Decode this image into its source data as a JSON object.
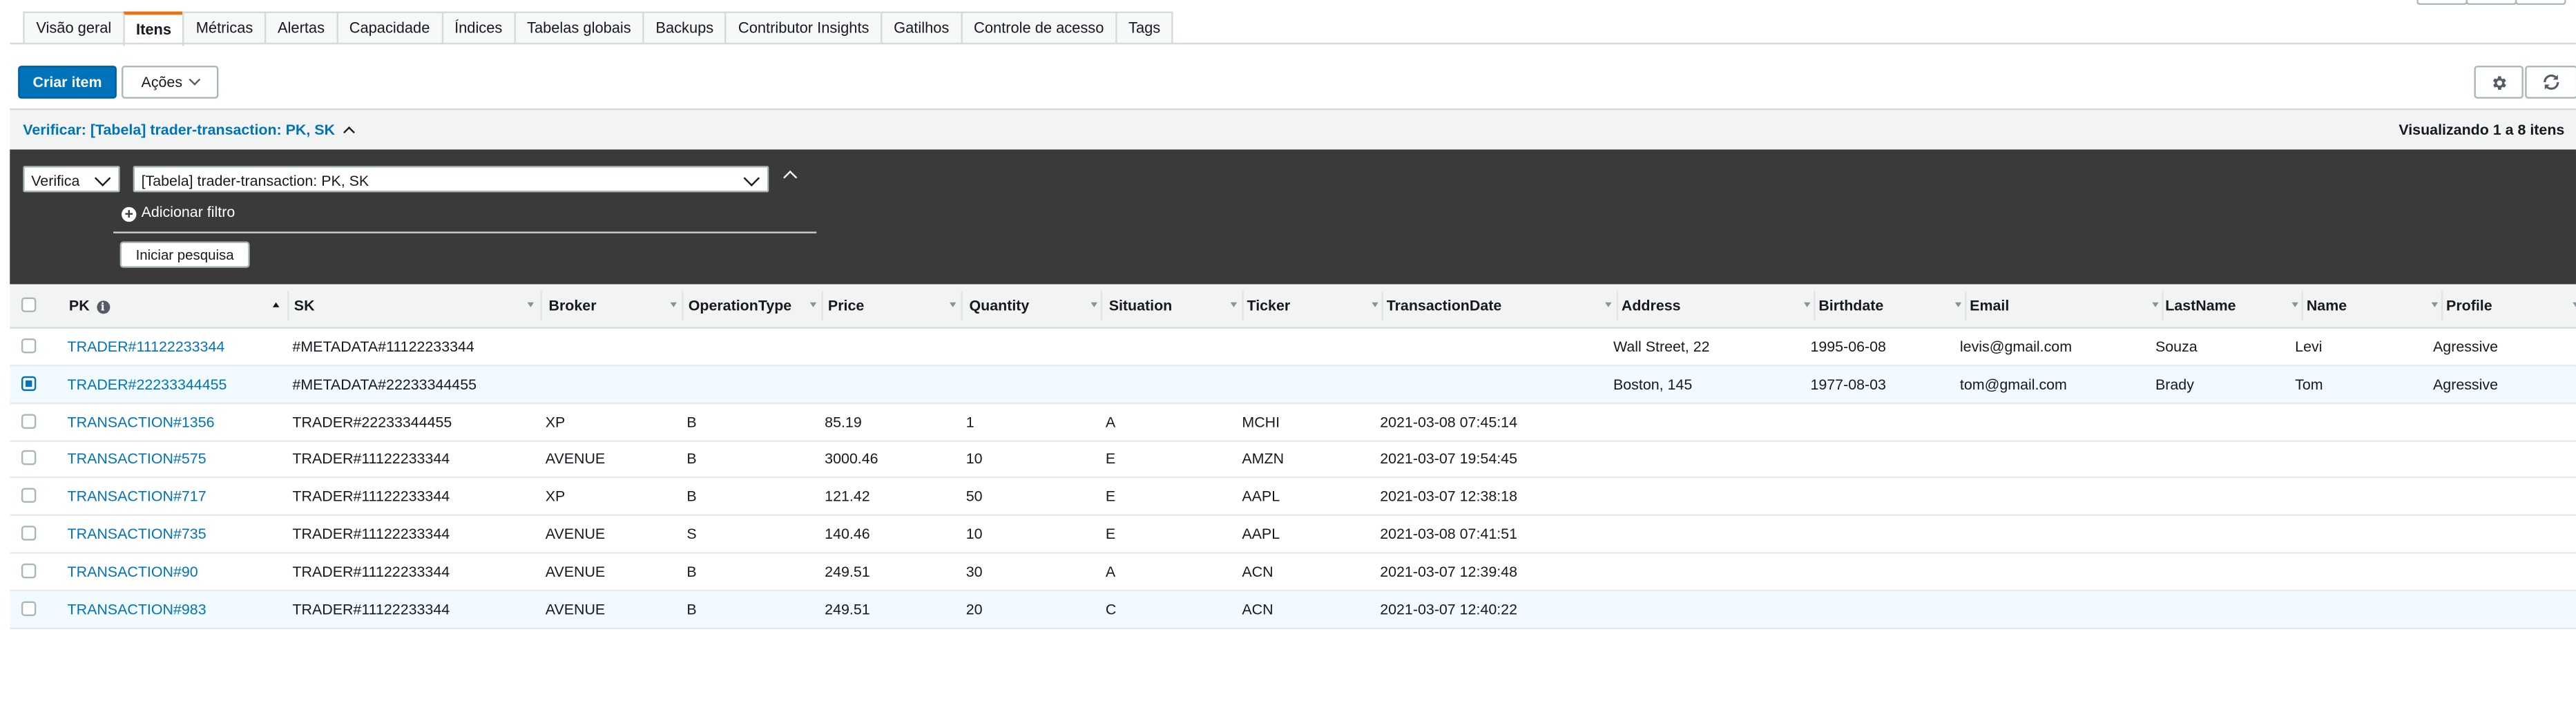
{
  "tabs": [
    "Visão geral",
    "Itens",
    "Métricas",
    "Alertas",
    "Capacidade",
    "Índices",
    "Tabelas globais",
    "Backups",
    "Contributor Insights",
    "Gatilhos",
    "Controle de acesso",
    "Tags"
  ],
  "active_tab": "Itens",
  "toolbar": {
    "create_label": "Criar item",
    "actions_label": "Ações"
  },
  "icons": {
    "settings": "gear-icon",
    "refresh": "refresh-icon",
    "info": "info-icon",
    "add": "plus-circle-icon"
  },
  "scan": {
    "title": "Verificar: [Tabela] trader-transaction: PK, SK",
    "count": "Visualizando 1 a 8 itens",
    "mode": "Verifica",
    "target": "[Tabela] trader-transaction: PK, SK",
    "add_filter": "Adicionar filtro",
    "start_search": "Iniciar pesquisa"
  },
  "table": {
    "columns": [
      "PK",
      "SK",
      "Broker",
      "OperationType",
      "Price",
      "Quantity",
      "Situation",
      "Ticker",
      "TransactionDate",
      "Address",
      "Birthdate",
      "Email",
      "LastName",
      "Name",
      "Profile"
    ],
    "rows": [
      {
        "selected": false,
        "cells": [
          "TRADER#11122233344",
          "#METADATA#11122233344",
          "",
          "",
          "",
          "",
          "",
          "",
          "",
          "Wall Street, 22",
          "1995-06-08",
          "levis@gmail.com",
          "Souza",
          "Levi",
          "Agressive"
        ]
      },
      {
        "selected": true,
        "cells": [
          "TRADER#22233344455",
          "#METADATA#22233344455",
          "",
          "",
          "",
          "",
          "",
          "",
          "",
          "Boston, 145",
          "1977-08-03",
          "tom@gmail.com",
          "Brady",
          "Tom",
          "Agressive"
        ]
      },
      {
        "selected": false,
        "cells": [
          "TRANSACTION#1356",
          "TRADER#22233344455",
          "XP",
          "B",
          "85.19",
          "1",
          "A",
          "MCHI",
          "2021-03-08 07:45:14",
          "",
          "",
          "",
          "",
          "",
          ""
        ]
      },
      {
        "selected": false,
        "cells": [
          "TRANSACTION#575",
          "TRADER#11122233344",
          "AVENUE",
          "B",
          "3000.46",
          "10",
          "E",
          "AMZN",
          "2021-03-07 19:54:45",
          "",
          "",
          "",
          "",
          "",
          ""
        ]
      },
      {
        "selected": false,
        "cells": [
          "TRANSACTION#717",
          "TRADER#11122233344",
          "XP",
          "B",
          "121.42",
          "50",
          "E",
          "AAPL",
          "2021-03-07 12:38:18",
          "",
          "",
          "",
          "",
          "",
          ""
        ]
      },
      {
        "selected": false,
        "cells": [
          "TRANSACTION#735",
          "TRADER#11122233344",
          "AVENUE",
          "S",
          "140.46",
          "10",
          "E",
          "AAPL",
          "2021-03-08 07:41:51",
          "",
          "",
          "",
          "",
          "",
          ""
        ]
      },
      {
        "selected": false,
        "cells": [
          "TRANSACTION#90",
          "TRADER#11122233344",
          "AVENUE",
          "B",
          "249.51",
          "30",
          "A",
          "ACN",
          "2021-03-07 12:39:48",
          "",
          "",
          "",
          "",
          "",
          ""
        ]
      },
      {
        "selected": false,
        "cells": [
          "TRANSACTION#983",
          "TRADER#11122233344",
          "AVENUE",
          "B",
          "249.51",
          "20",
          "C",
          "ACN",
          "2021-03-07 12:40:22",
          "",
          "",
          "",
          "",
          "",
          ""
        ]
      }
    ]
  },
  "colors": {
    "link": "#0073bb",
    "primary": "#0073bb",
    "tab_accent": "#ec7211",
    "panel": "#3a3a3a"
  }
}
